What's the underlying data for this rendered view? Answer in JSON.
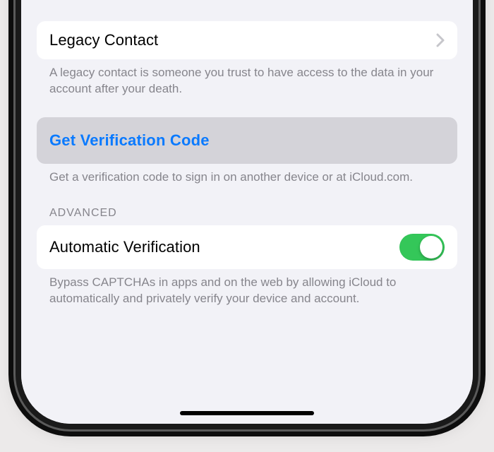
{
  "legacyContact": {
    "title": "Legacy Contact",
    "footer": "A legacy contact is someone you trust to have access to the data in your account after your death."
  },
  "verification": {
    "button": "Get Verification Code",
    "footer": "Get a verification code to sign in on another device or at iCloud.com."
  },
  "advanced": {
    "header": "ADVANCED",
    "automaticVerification": {
      "title": "Automatic Verification",
      "enabled": true,
      "footer": "Bypass CAPTCHAs in apps and on the web by allowing iCloud to automatically and privately verify your device and account."
    }
  },
  "colors": {
    "link": "#0a7aff",
    "toggleOn": "#34c759",
    "groupedBg": "#f2f2f7"
  }
}
